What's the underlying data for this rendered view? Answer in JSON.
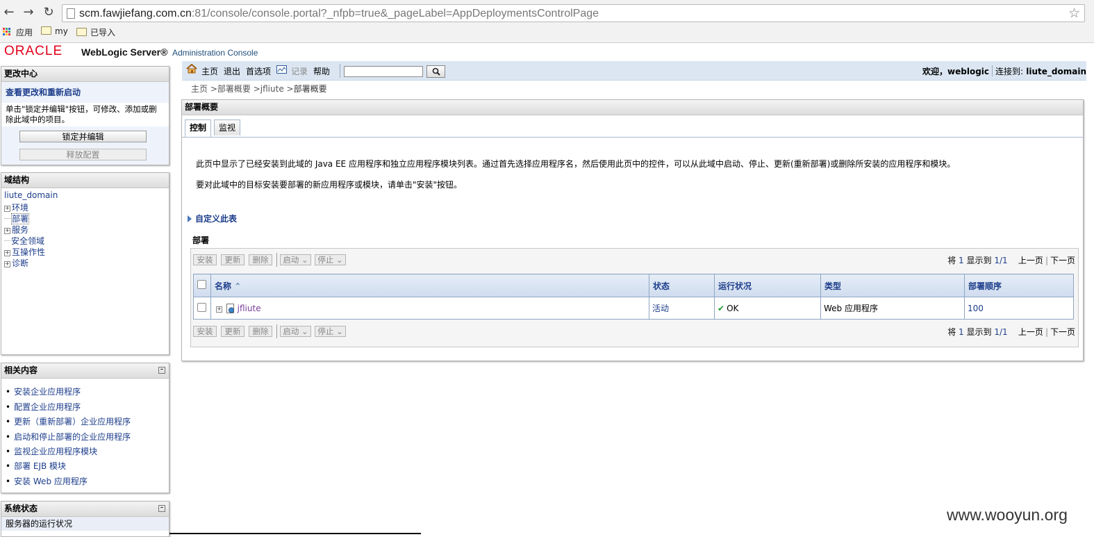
{
  "browser": {
    "url_host": "scm.fawjiefang.com.cn",
    "url_rest": ":81/console/console.portal?_nfpb=true&_pageLabel=AppDeploymentsControlPage",
    "bookmarks": [
      {
        "label": "应用"
      },
      {
        "label": "my"
      },
      {
        "label": "已导入"
      }
    ]
  },
  "header": {
    "logo": "ORACLE",
    "product": "WebLogic Server®",
    "subtitle": "Administration Console"
  },
  "change_center": {
    "title": "更改中心",
    "link": "查看更改和重新启动",
    "description": "单击\"锁定并编辑\"按钮，可修改、添加或删除此域中的项目。",
    "lock_button": "锁定并编辑",
    "release_button": "释放配置"
  },
  "domain_structure": {
    "title": "域结构",
    "root": "liute_domain",
    "items": [
      {
        "label": "环境",
        "expandable": true
      },
      {
        "label": "部署",
        "expandable": false
      },
      {
        "label": "服务",
        "expandable": true
      },
      {
        "label": "安全领域",
        "expandable": false
      },
      {
        "label": "互操作性",
        "expandable": true
      },
      {
        "label": "诊断",
        "expandable": true
      }
    ]
  },
  "related": {
    "title": "相关内容",
    "items": [
      "安装企业应用程序",
      "配置企业应用程序",
      "更新（重新部署）企业应用程序",
      "启动和停止部署的企业应用程序",
      "监视企业应用程序模块",
      "部署 EJB 模块",
      "安装 Web 应用程序"
    ]
  },
  "system_status": {
    "title": "系统状态",
    "row": "服务器的运行状况"
  },
  "toolbar": {
    "home": "主页",
    "logout": "退出",
    "preferences": "首选项",
    "record": "记录",
    "help": "帮助",
    "search_value": "",
    "welcome_label": "欢迎，",
    "user": "weblogic",
    "connected_label": "连接到:",
    "domain": "liute_domain"
  },
  "breadcrumb": {
    "home": "主页",
    "deploy_summary": "部署概要",
    "app": "jfliute",
    "current": "部署概要"
  },
  "main": {
    "title": "部署概要",
    "tabs": [
      "控制",
      "监视"
    ],
    "para1": "此页中显示了已经安装到此域的 Java EE 应用程序和独立应用程序模块列表。通过首先选择应用程序名，然后使用此页中的控件，可以从此域中启动、停止、更新(重新部署)或删除所安装的应用程序和模块。",
    "para2": "要对此域中的目标安装要部署的新应用程序或模块，请单击\"安装\"按钮。",
    "customize": "自定义此表",
    "table_title": "部署",
    "actions": {
      "install": "安装",
      "update": "更新",
      "delete": "删除",
      "start": "启动",
      "stop": "停止"
    },
    "pager": {
      "prefix": "将",
      "count": "1",
      "middle": "显示到",
      "range": "1/1",
      "prev": "上一页",
      "next": "下一页"
    },
    "columns": [
      "名称",
      "状态",
      "运行状况",
      "类型",
      "部署顺序"
    ],
    "rows": [
      {
        "name": "jfliute",
        "state": "活动",
        "health": "OK",
        "type": "Web 应用程序",
        "order": "100"
      }
    ]
  },
  "watermark": "www.wooyun.org"
}
